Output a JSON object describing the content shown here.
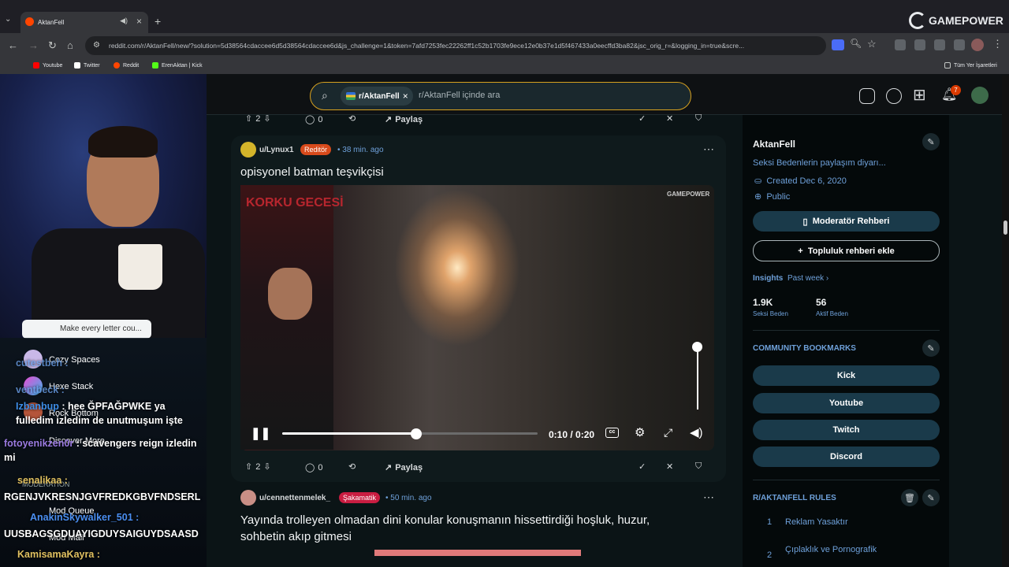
{
  "browser": {
    "tab_title": "AktanFell",
    "url": "reddit.com/r/AktanFell/new/?solution=5d38564cdaccee6d5d38564cdaccee6d&js_challenge=1&token=7afd7253fec22262ff1c52b1703fe9ece12e0b37e1d5f467433a0eecffd3ba82&jsc_orig_r=&logging_in=true&scre...",
    "bookmarks": [
      {
        "label": "Youtube",
        "color": "#ff0000"
      },
      {
        "label": "Twitter",
        "color": "#ffffff"
      },
      {
        "label": "Reddit",
        "color": "#ff4500"
      },
      {
        "label": "ErenAktan | Kick",
        "color": "#53fc18"
      }
    ],
    "all_bookmarks": "Tüm Yer İşaretleri"
  },
  "overlay": {
    "brand": "GAMEPOWER",
    "textbox": "Make every letter cou...",
    "nav": [
      "Cozy Spaces",
      "Hexe Stack",
      "Rock Bottom",
      "Discover More",
      "MODERATION",
      "Mod Queue",
      "Mod Mail"
    ],
    "chat": [
      {
        "user": "cutestbeh :",
        "text": ""
      },
      {
        "user": "ventbeck :",
        "text": ""
      },
      {
        "user": "Izbanbup",
        "text": ": hee ĞPFAĞPWKE ya fulledim izledim de unutmuşum işte"
      },
      {
        "user": "fotoyenikzen0r",
        "text": ": scavengers reign izledin mi"
      },
      {
        "user": "senalikaa :",
        "text": "RGENJVKRESNJGVFREDKGBVFNDSERL"
      },
      {
        "user": "AnakinSkywalker_501 :",
        "text": "UUSBAGSGDUAYIGDUYSAIGUYDSAASD"
      },
      {
        "user": "KamisamaKayra :",
        "text": ""
      }
    ]
  },
  "reddit": {
    "search_chip": "r/AktanFell",
    "search_placeholder": "r/AktanFell içinde ara",
    "notif_count": "7",
    "prev_post": {
      "votes": "2",
      "comments": "0",
      "share": "Paylaş"
    },
    "post1": {
      "user": "u/Lynux1",
      "flair": "Reditör",
      "flair_color": "#d84a1b",
      "time": "38 min. ago",
      "title": "opisyonel batman teşvikçisi",
      "video_time": "0:10 / 0:20",
      "progress_fraction": 0.52,
      "overlay_title": "KORKU GECESİ",
      "overlay_brand": "GAMEPOWER",
      "votes": "2",
      "comments": "0",
      "share": "Paylaş"
    },
    "post2": {
      "user": "u/cennettenmelek_",
      "flair": "Şakamatik",
      "flair_color": "#c91d41",
      "time": "50 min. ago",
      "title": "Yayında trolleyen olmadan dini konular konuşmanın hissettirdiği hoşluk, huzur, sohbetin akıp gitmesi"
    }
  },
  "sidebar": {
    "name": "AktanFell",
    "description": "Seksi Bedenlerin paylaşım diyarı...",
    "created": "Created Dec 6, 2020",
    "visibility": "Public",
    "mod_guide": "Moderatör Rehberi",
    "add_guide": "Topluluk rehberi ekle",
    "insights": "Insights",
    "insights_period": "Past week",
    "stat1_value": "1.9K",
    "stat1_label": "Seksi Beden",
    "stat2_value": "56",
    "stat2_label": "Aktif Beden",
    "bookmarks_title": "COMMUNITY BOOKMARKS",
    "bookmarks": [
      "Kick",
      "Youtube",
      "Twitch",
      "Discord"
    ],
    "rules_title": "R/AKTANFELL RULES",
    "rules": [
      {
        "num": "1",
        "text": "Reklam Yasaktır"
      },
      {
        "num": "2",
        "text": "Çıplaklık ve Pornografik"
      }
    ]
  }
}
